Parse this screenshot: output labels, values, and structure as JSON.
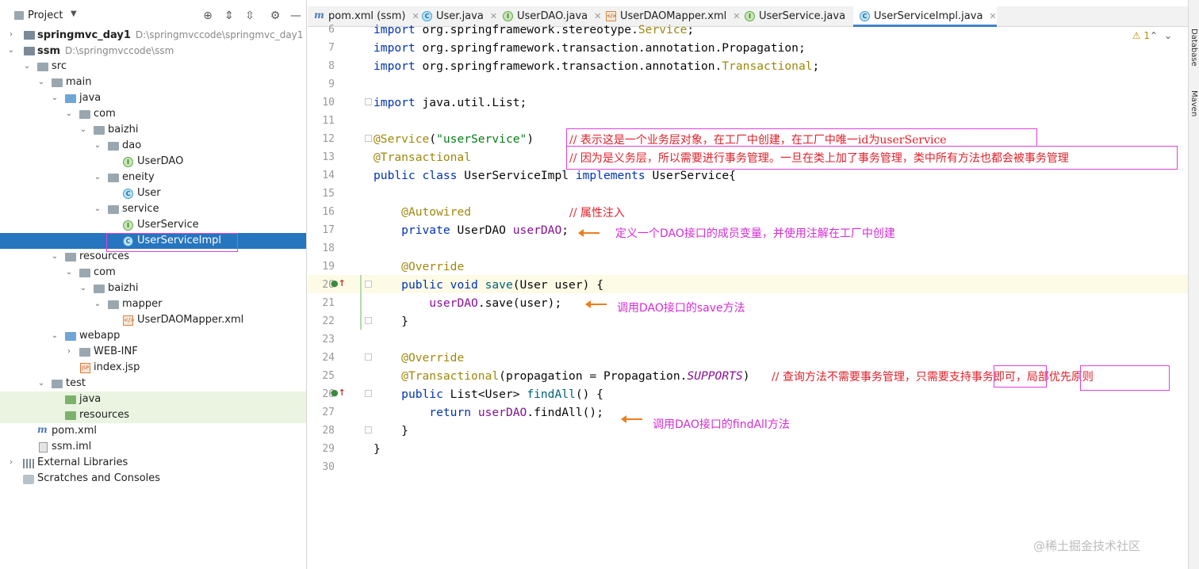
{
  "project": {
    "title": "Project",
    "tree": [
      {
        "label": "springmvc_day1",
        "path": "D:\\springmvccode\\springmvc_day1",
        "bold": true
      },
      {
        "label": "ssm",
        "path": "D:\\springmvccode\\ssm",
        "bold": true
      },
      {
        "label": "src"
      },
      {
        "label": "main"
      },
      {
        "label": "java"
      },
      {
        "label": "com"
      },
      {
        "label": "baizhi"
      },
      {
        "label": "dao"
      },
      {
        "label": "UserDAO"
      },
      {
        "label": "eneity"
      },
      {
        "label": "User"
      },
      {
        "label": "service"
      },
      {
        "label": "UserService"
      },
      {
        "label": "UserServiceImpl"
      },
      {
        "label": "resources"
      },
      {
        "label": "com"
      },
      {
        "label": "baizhi"
      },
      {
        "label": "mapper"
      },
      {
        "label": "UserDAOMapper.xml"
      },
      {
        "label": "webapp"
      },
      {
        "label": "WEB-INF"
      },
      {
        "label": "index.jsp"
      },
      {
        "label": "test"
      },
      {
        "label": "java"
      },
      {
        "label": "resources"
      },
      {
        "label": "pom.xml"
      },
      {
        "label": "ssm.iml"
      },
      {
        "label": "External Libraries"
      },
      {
        "label": "Scratches and Consoles"
      }
    ]
  },
  "tabs": [
    {
      "label": "pom.xml (ssm)",
      "icon": "maven-icon"
    },
    {
      "label": "User.java",
      "icon": "class-icon"
    },
    {
      "label": "UserDAO.java",
      "icon": "interface-icon"
    },
    {
      "label": "UserDAOMapper.xml",
      "icon": "xml-icon"
    },
    {
      "label": "UserService.java",
      "icon": "interface-icon"
    },
    {
      "label": "UserServiceImpl.java",
      "icon": "class-icon",
      "active": true
    }
  ],
  "editor": {
    "warnings": "1",
    "line_numbers": [
      "6",
      "7",
      "8",
      "9",
      "10",
      "11",
      "12",
      "13",
      "14",
      "15",
      "16",
      "17",
      "18",
      "19",
      "20",
      "21",
      "22",
      "23",
      "24",
      "25",
      "26",
      "27",
      "28",
      "29",
      "30"
    ],
    "comments": {
      "line12": "// 表示这是一个业务层对象，在工厂中创建，在工厂中唯一id为userService",
      "line13": "// 因为是义务层，所以需要进行事务管理。一旦在类上加了事务管理，类中所有方法也都会被事务管理",
      "line16": "// 属性注入",
      "line25": "// 查询方法不需要事务管理，只需要支持事务即可，局部优先原则"
    },
    "notes": {
      "line17": "定义一个DAO接口的成员变量，并使用注解在工厂中创建",
      "line21": "调用DAO接口的save方法",
      "line27": "调用DAO接口的findAll方法"
    }
  },
  "right_tools": [
    "Database",
    "Maven"
  ],
  "watermark": "@稀土掘金技术社区"
}
